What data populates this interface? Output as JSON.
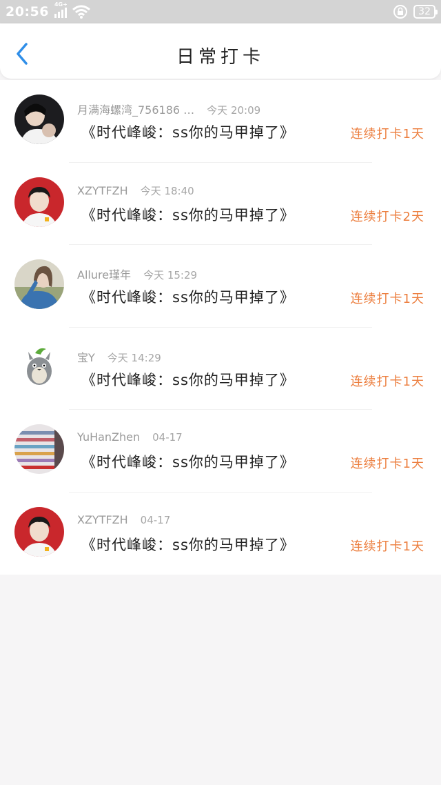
{
  "status_bar": {
    "time": "20:56",
    "network": "4G+",
    "battery": "32"
  },
  "nav": {
    "title": "日常打卡"
  },
  "items": [
    {
      "username": "月满海螺湾_756186 …",
      "time": "今天 20:09",
      "post": "《时代峰峻：ss你的马甲掉了》",
      "streak": "连续打卡1天"
    },
    {
      "username": "XZYTFZH",
      "time": "今天 18:40",
      "post": "《时代峰峻：ss你的马甲掉了》",
      "streak": "连续打卡2天"
    },
    {
      "username": "Allure瑾年",
      "time": "今天 15:29",
      "post": "《时代峰峻：ss你的马甲掉了》",
      "streak": "连续打卡1天"
    },
    {
      "username": "宝Y",
      "time": "今天 14:29",
      "post": "《时代峰峻：ss你的马甲掉了》",
      "streak": "连续打卡1天"
    },
    {
      "username": "YuHanZhen",
      "time": "04-17",
      "post": "《时代峰峻：ss你的马甲掉了》",
      "streak": "连续打卡1天"
    },
    {
      "username": "XZYTFZH",
      "time": "04-17",
      "post": "《时代峰峻：ss你的马甲掉了》",
      "streak": "连续打卡1天"
    }
  ],
  "colors": {
    "accent": "#2f8ee8",
    "streak": "#ec7e3e",
    "background": "#f6f5f6"
  }
}
